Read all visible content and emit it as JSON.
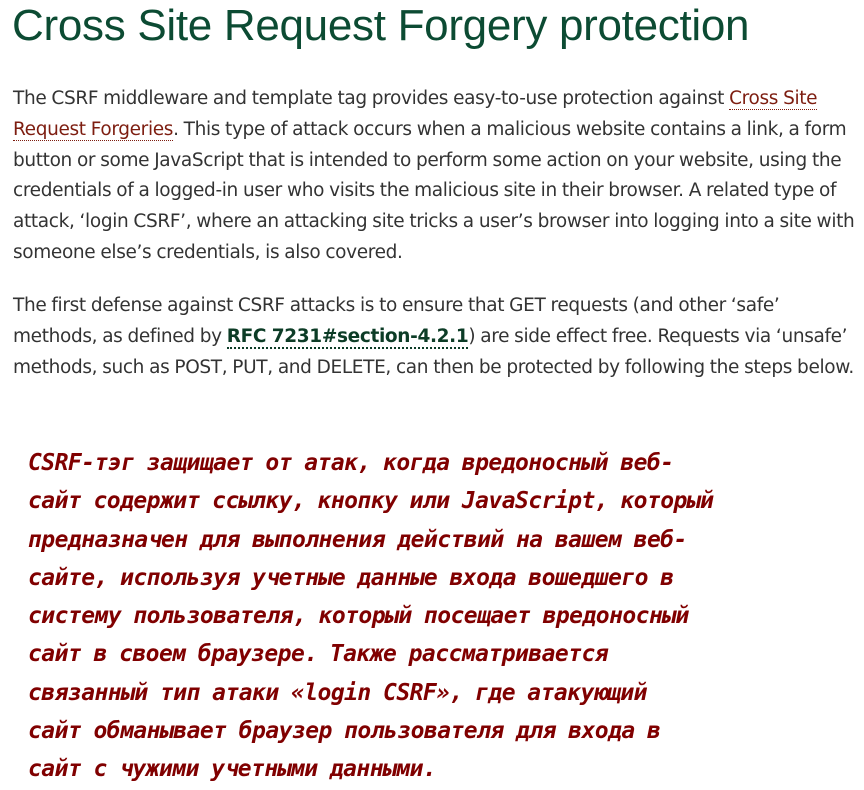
{
  "title": "Cross Site Request Forgery protection",
  "paragraph1": {
    "text_before": "The CSRF middleware and template tag provides easy-to-use protection against ",
    "link": "Cross Site Request Forgeries",
    "text_after": ". This type of attack occurs when a malicious website contains a link, a form button or some JavaScript that is intended to perform some action on your website, using the credentials of a logged-in user who visits the malicious site in their browser. A related type of attack, ‘login CSRF’, where an attacking site tricks a user’s browser into logging into a site with someone else’s credentials, is also covered."
  },
  "paragraph2": {
    "text_before": "The first defense against CSRF attacks is to ensure that GET requests (and other ‘safe’ methods, as defined by ",
    "link": "RFC 7231#section-4.2.1",
    "text_after": ") are side effect free. Requests via ‘unsafe’ methods, such as POST, PUT, and DELETE, can then be protected by following the steps below."
  },
  "translation_note": {
    "lines": [
      "CSRF-тэг защищает от атак, когда вредоносный веб-",
      "сайт содержит ссылку, кнопку или JavaScript, который",
      "предназначен для выполнения действий на вашем веб-",
      "сайте, используя учетные данные входа вошедшего в",
      "систему пользователя, который посещает вредоносный",
      "сайт в своем браузере. Также рассматривается",
      "связанный тип атаки «login CSRF», где атакующий",
      "сайт обманывает браузер пользователя для входа в",
      "сайт с чужими учетными данными."
    ]
  },
  "colors": {
    "title": "#0c4b33",
    "body_text": "#333333",
    "link": "#7d1d10",
    "rfc_link": "#0c3c26",
    "note_text": "#800000",
    "background": "#ffffff"
  }
}
